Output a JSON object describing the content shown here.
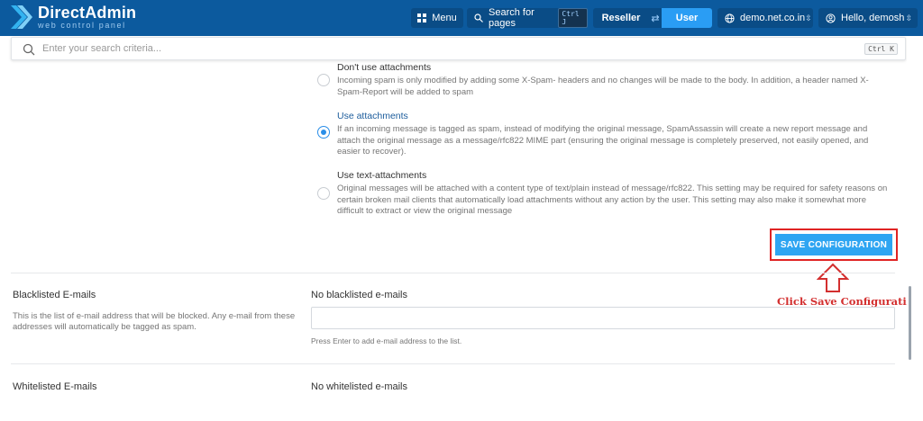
{
  "app": {
    "logo_title": "DirectAdmin",
    "logo_subtitle": "web control panel"
  },
  "topbar": {
    "menu_label": "Menu",
    "search_label": "Search for pages",
    "search_shortcut": "Ctrl J",
    "switch_reseller": "Reseller",
    "switch_user": "User",
    "domain": "demo.net.co.in",
    "hello": "Hello, demosh"
  },
  "search": {
    "placeholder": "Enter your search criteria...",
    "shortcut": "Ctrl K"
  },
  "options": [
    {
      "title": "Don't use attachments",
      "desc": "Incoming spam is only modified by adding some X-Spam- headers and no changes will be made to the body. In addition, a header named X-Spam-Report will be added to spam",
      "selected": false
    },
    {
      "title": "Use attachments",
      "desc": "If an incoming message is tagged as spam, instead of modifying the original message, SpamAssassin will create a new report message and attach the original message as a message/rfc822 MIME part (ensuring the original message is completely preserved, not easily opened, and easier to recover).",
      "selected": true
    },
    {
      "title": "Use text-attachments",
      "desc": "Original messages will be attached with a content type of text/plain instead of message/rfc822. This setting may be required for safety reasons on certain broken mail clients that automatically load attachments without any action by the user. This setting may also make it somewhat more difficult to extract or view the original message",
      "selected": false
    }
  ],
  "save_button": "SAVE CONFIGURATION",
  "annotation": "Click Save Configuration",
  "blacklist": {
    "title": "Blacklisted E-mails",
    "desc": "This is the list of e-mail address that will be blocked. Any e-mail from these addresses will automatically be tagged as spam.",
    "field_label": "No blacklisted e-mails",
    "hint": "Press Enter to add e-mail address to the list."
  },
  "whitelist": {
    "title": "Whitelisted E-mails",
    "field_label": "No whitelisted e-mails"
  },
  "colors": {
    "topbar": "#0c5a9e",
    "accent": "#2ea5f2",
    "annotation": "#d32f2f"
  }
}
